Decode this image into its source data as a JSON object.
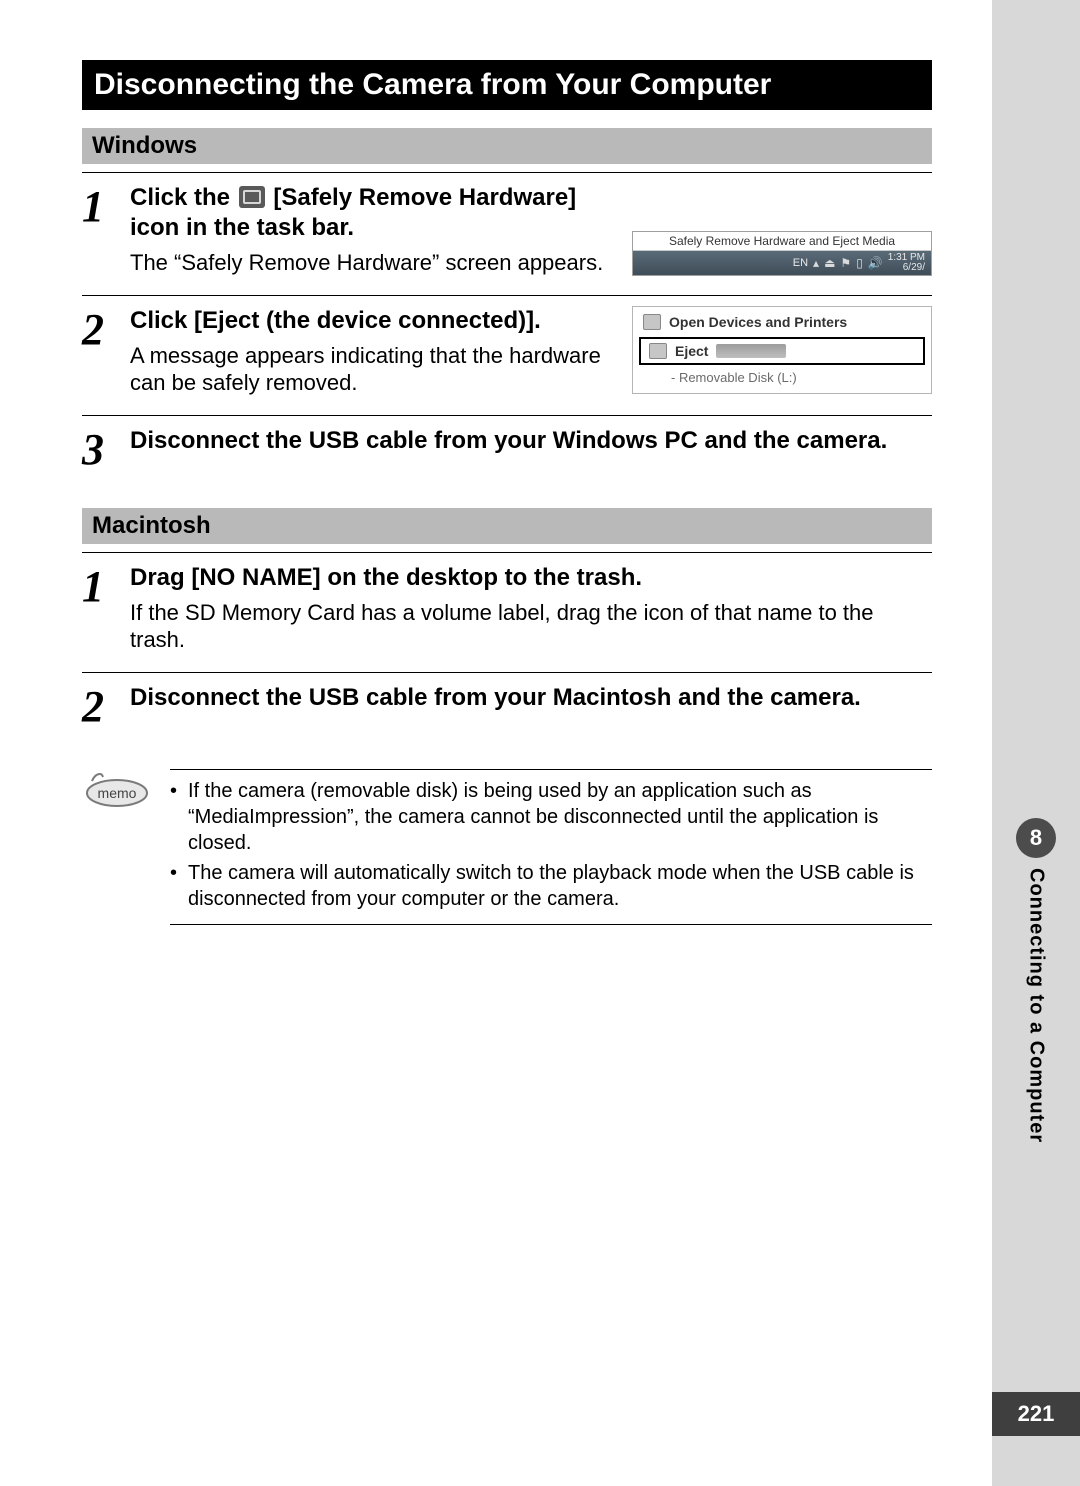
{
  "mainTitle": "Disconnecting the Camera from Your Computer",
  "sections": {
    "windows": {
      "header": "Windows",
      "steps": [
        {
          "num": "1",
          "heading_pre": "Click the ",
          "heading_post": " [Safely Remove Hardware] icon in the task bar.",
          "desc": "The “Safely Remove Hardware” screen appears.",
          "shot": {
            "balloon": "Safely Remove Hardware and Eject Media",
            "tray_lang": "EN",
            "tray_time": "1:31 PM",
            "tray_date": "6/29/"
          }
        },
        {
          "num": "2",
          "heading": "Click [Eject (the device connected)].",
          "desc": "A message appears indicating that the hardware can be safely removed.",
          "shot": {
            "open_devices": "Open Devices and Printers",
            "eject_label": "Eject",
            "sub": "-   Removable Disk (L:)"
          }
        },
        {
          "num": "3",
          "heading": "Disconnect the USB cable from your Windows PC and the camera."
        }
      ]
    },
    "mac": {
      "header": "Macintosh",
      "steps": [
        {
          "num": "1",
          "heading": "Drag [NO NAME] on the desktop to the trash.",
          "desc": "If the SD Memory Card has a volume label, drag the icon of that name to the trash."
        },
        {
          "num": "2",
          "heading": "Disconnect the USB cable from your Macintosh and the camera."
        }
      ]
    }
  },
  "memo": {
    "badge_text": "memo",
    "bullets": [
      "If the camera (removable disk) is being used by an application such as “MediaImpression”, the camera cannot be disconnected until the application is closed.",
      "The camera will automatically switch to the playback mode when the USB cable is disconnected from your computer or the camera."
    ]
  },
  "side": {
    "chapter": "8",
    "label": "Connecting to a Computer"
  },
  "page_number": "221"
}
